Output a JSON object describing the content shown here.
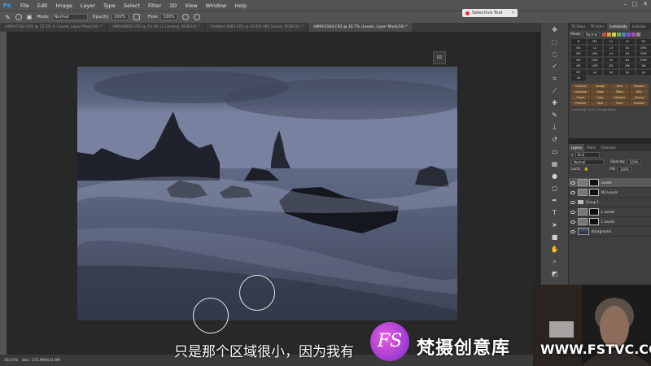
{
  "app": {
    "logo": "Ps"
  },
  "menu": [
    "File",
    "Edit",
    "Image",
    "Layer",
    "Type",
    "Select",
    "Filter",
    "3D",
    "View",
    "Window",
    "Help"
  ],
  "options": {
    "mode_label": "Mode:",
    "mode_value": "Normal",
    "opacity_label": "Opacity:",
    "opacity_value": "100%",
    "flow_label": "Flow:",
    "flow_value": "100%"
  },
  "selective_tool": {
    "label": "Selective Tool"
  },
  "doc_tabs": [
    "HMSA7342.CR2 @ 12.5% (L Levels, Layer Mask/16) *",
    "HMSA8016.CR2 @ 14.3% (L Camera, RGB/16) *",
    "Untitled-1064.CR2 @ 20.6% (M2 Levels, RGB/16) *",
    "HMSA3164.CR2 @ 16.7% (Levels, Layer Mask/16) *"
  ],
  "navigator_button": "02",
  "status": {
    "zoom": "16.67%",
    "doc": "Doc: 172.9M/431.9M"
  },
  "luminosity": {
    "tabs": [
      "TK Steps",
      "TK Actns",
      "Luminosity",
      "Initialize"
    ],
    "mode_label": "Mode:",
    "mode_value": "Normal",
    "swatch_colors": [
      "#c94a4a",
      "#d2a33a",
      "#d8d23a",
      "#5fb35a",
      "#4a86c9",
      "#7a55c9",
      "#b04ab0",
      "#888888"
    ],
    "grid": [
      "D",
      "M1",
      "L1",
      "L2",
      "D1",
      "M2",
      "L2",
      "L3",
      "D2",
      "DM1",
      "M3",
      "LM1",
      "L4",
      "D3",
      "DM2",
      "M4",
      "LM2",
      "L5",
      "D4",
      "DM3",
      "M5",
      "LM3",
      "D5",
      "M6",
      "D6",
      "M7",
      "(x)",
      "(x)",
      "(x)",
      "(x)",
      "Vo"
    ],
    "actions": [
      "Contrast",
      "Dodge",
      "Burn",
      "Sharpen",
      "Combine",
      "Edge",
      "Mask",
      "Blur",
      "Smart",
      "Color",
      "Saturate",
      "Stamp",
      "Prefilled",
      "Split",
      "Paint",
      "Sharpen"
    ],
    "footer": "Luminosity v4.0.1 (Flying Bear)"
  },
  "layers": {
    "tabs": [
      "Layers",
      "Paths",
      "Channels"
    ],
    "kind_label": "Kind",
    "blend": "Normal",
    "opacity_label": "Opacity:",
    "opacity_value": "100%",
    "lock_label": "Lock:",
    "fill_label": "Fill:",
    "fill_value": "100%",
    "items": [
      {
        "name": "Levels",
        "type": "adjust",
        "selected": true
      },
      {
        "name": "M2 Levels",
        "type": "adjust",
        "selected": false
      },
      {
        "name": "Group 1",
        "type": "group",
        "selected": false
      },
      {
        "name": "L Levels",
        "type": "adjust",
        "selected": false
      },
      {
        "name": "L Levels",
        "type": "adjust",
        "selected": false
      },
      {
        "name": "Background",
        "type": "photo",
        "selected": false
      }
    ]
  },
  "subtitle": "只是那个区域很小，因为我有",
  "watermark": {
    "logo": "FS",
    "name": "梵摄创意库",
    "url": "WWW.FSTVC.CC"
  }
}
